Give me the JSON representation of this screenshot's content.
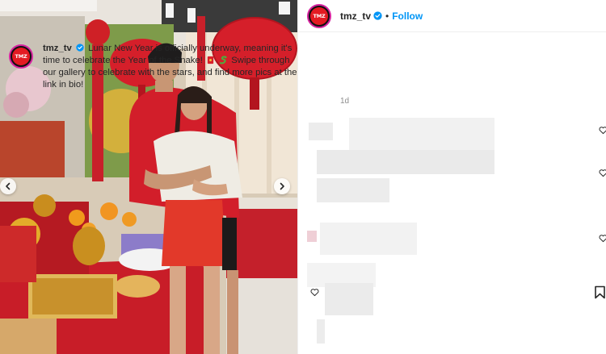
{
  "post": {
    "username": "tmz_tv",
    "avatar_text": "TMZ",
    "separator": "•",
    "follow_label": "Follow",
    "caption_user": "tmz_tv",
    "caption_part1": "Lunar New Year is officially underway, meaning it's time to celebrate the Year of the Snake!",
    "caption_part2": "Swipe through our gallery to celebrate with the stars, and find more pics at the link in bio!",
    "time_ago": "1d"
  },
  "icons": {
    "verified": "verified-badge-icon",
    "prev": "chevron-left-icon",
    "next": "chevron-right-icon",
    "like": "heart-icon",
    "save": "bookmark-icon",
    "emoji_1": "red-envelope-emoji",
    "emoji_2": "snake-emoji"
  },
  "colors": {
    "link": "#0095f6",
    "verified": "#0095f6",
    "brand": "#e31b23",
    "text": "#262626",
    "muted": "#8e8e8e"
  }
}
